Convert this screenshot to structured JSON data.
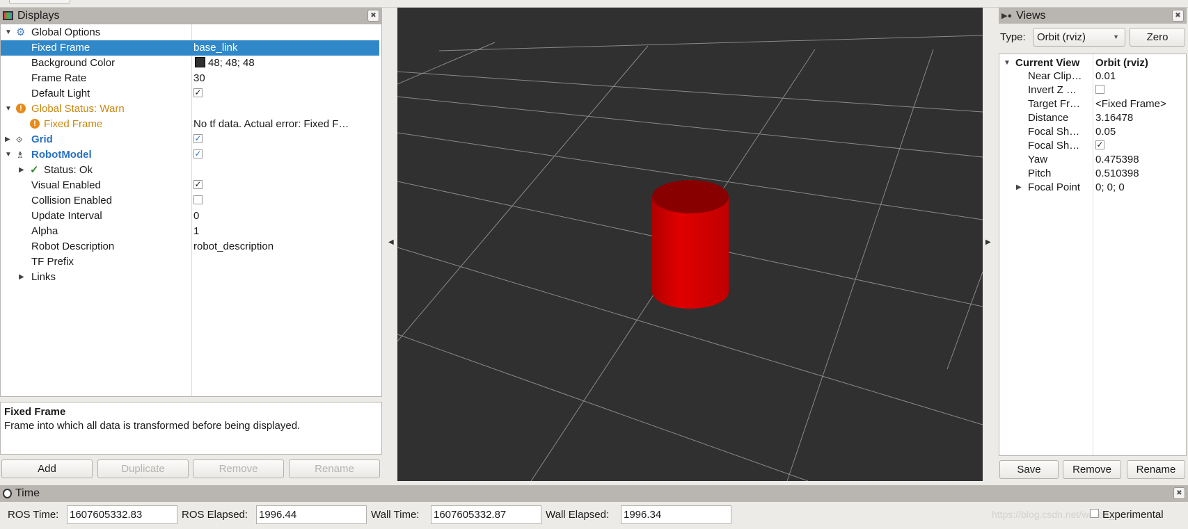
{
  "colors": {
    "selection": "#3088c8",
    "warn": "#c9870f",
    "link": "#2a72c0",
    "viewport_bg": "#303030",
    "grid": "#a0a0a0",
    "cylinder": "#dd0000"
  },
  "displays": {
    "title": "Displays",
    "rows": [
      {
        "label": "Global Options",
        "value": "",
        "icon": "gear-icon",
        "expanded": true
      },
      {
        "label": "Fixed Frame",
        "value": "base_link",
        "selected": true
      },
      {
        "label": "Background Color",
        "value": "48; 48; 48",
        "swatch": "#303030"
      },
      {
        "label": "Frame Rate",
        "value": "30"
      },
      {
        "label": "Default Light",
        "checked": true
      },
      {
        "label": "Global Status: Warn",
        "icon": "warning-icon",
        "expanded": true
      },
      {
        "label": "Fixed Frame",
        "value": "No tf data.  Actual error: Fixed F…",
        "icon": "warning-icon"
      },
      {
        "label": "Grid",
        "checked": true,
        "icon": "grid-icon"
      },
      {
        "label": "RobotModel",
        "checked": true,
        "icon": "robot-icon",
        "expanded": true
      },
      {
        "label": "Status: Ok",
        "icon": "check-icon"
      },
      {
        "label": "Visual Enabled",
        "checked": true
      },
      {
        "label": "Collision Enabled",
        "checked": false
      },
      {
        "label": "Update Interval",
        "value": "0"
      },
      {
        "label": "Alpha",
        "value": "1"
      },
      {
        "label": "Robot Description",
        "value": "robot_description"
      },
      {
        "label": "TF Prefix",
        "value": ""
      },
      {
        "label": "Links",
        "value": ""
      }
    ],
    "description_title": "Fixed Frame",
    "description_text": "Frame into which all data is transformed before being displayed.",
    "buttons": {
      "add": "Add",
      "duplicate": "Duplicate",
      "remove": "Remove",
      "rename": "Rename"
    }
  },
  "views": {
    "title": "Views",
    "type_label": "Type:",
    "type_value": "Orbit (rviz)",
    "zero": "Zero",
    "current_view_label": "Current View",
    "current_view_value": "Orbit (rviz)",
    "rows": [
      {
        "label": "Near Clip…",
        "value": "0.01"
      },
      {
        "label": "Invert Z …",
        "checked": false
      },
      {
        "label": "Target Fr…",
        "value": "<Fixed Frame>"
      },
      {
        "label": "Distance",
        "value": "3.16478"
      },
      {
        "label": "Focal Sh…",
        "value": "0.05"
      },
      {
        "label": "Focal Sh…",
        "checked": true
      },
      {
        "label": "Yaw",
        "value": "0.475398"
      },
      {
        "label": "Pitch",
        "value": "0.510398"
      },
      {
        "label": "Focal Point",
        "value": "0; 0; 0"
      }
    ],
    "buttons": {
      "save": "Save",
      "remove": "Remove",
      "rename": "Rename"
    }
  },
  "time": {
    "title": "Time",
    "ros_time_label": "ROS Time:",
    "ros_time": "1607605332.83",
    "ros_elapsed_label": "ROS Elapsed:",
    "ros_elapsed": "1996.44",
    "wall_time_label": "Wall Time:",
    "wall_time": "1607605332.87",
    "wall_elapsed_label": "Wall Elapsed:",
    "wall_elapsed": "1996.34",
    "experimental": "Experimental"
  },
  "watermark": "https://blog.csdn.net/weixin_..."
}
